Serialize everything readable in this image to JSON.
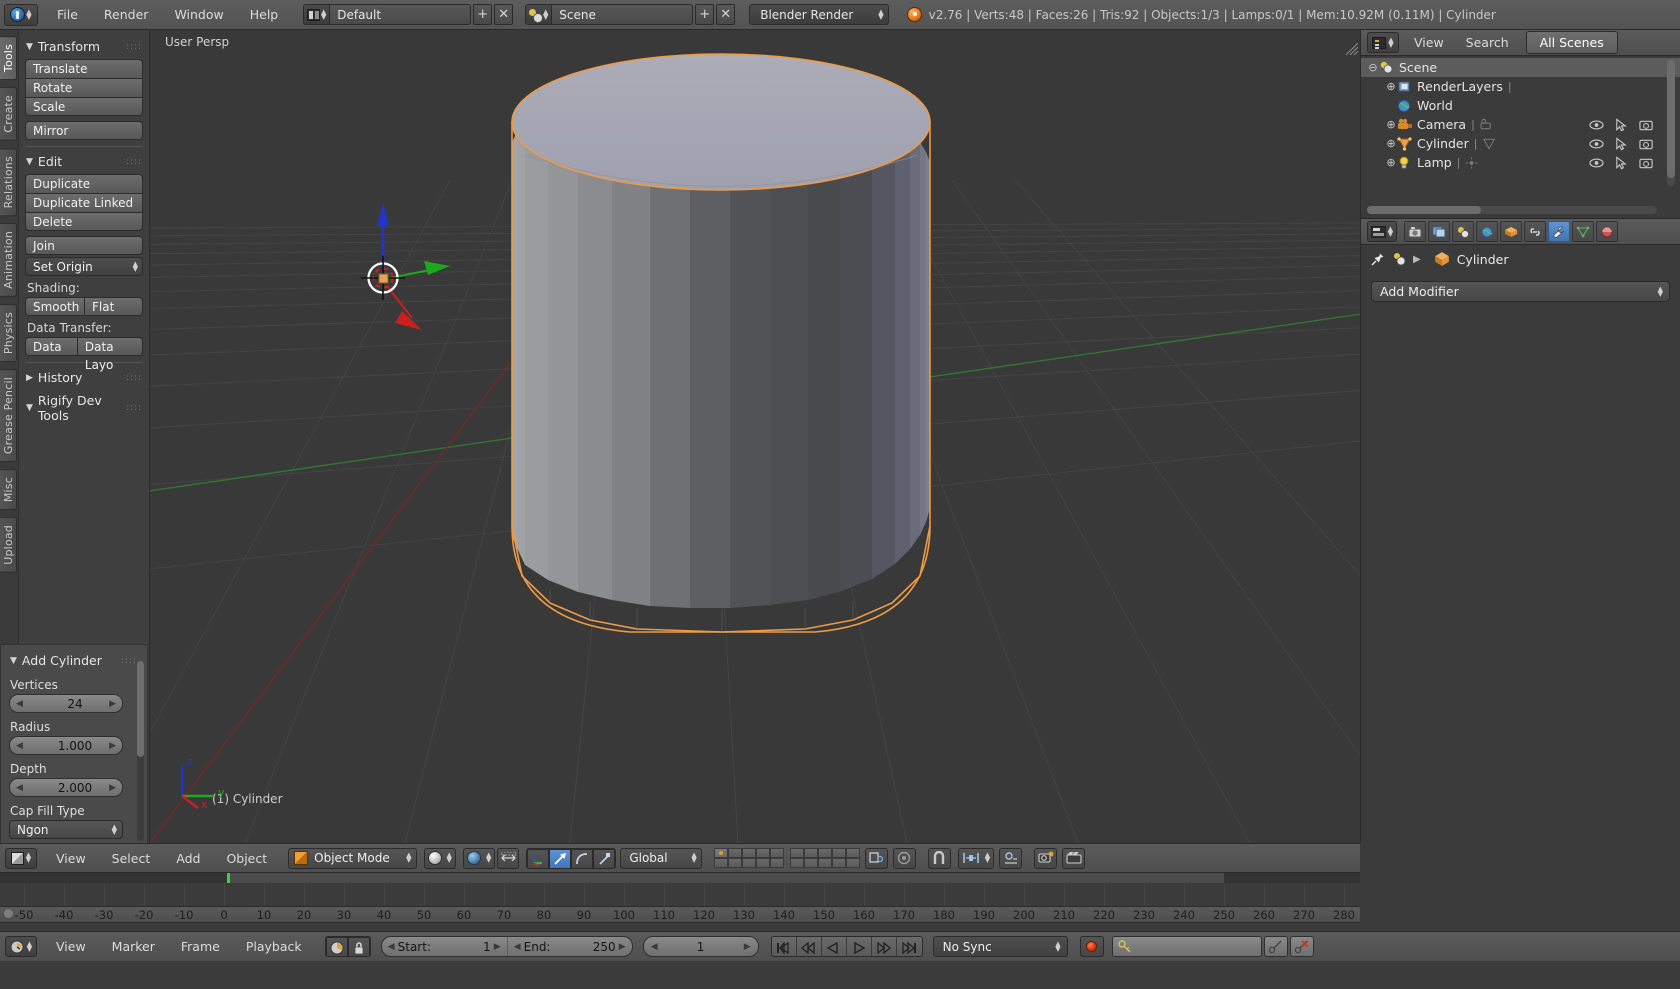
{
  "topbar": {
    "logo_icon": "blender-logo-icon",
    "menus": [
      "File",
      "Render",
      "Window",
      "Help"
    ],
    "screen_layout": {
      "icon": "screen-layout-icon",
      "value": "Default",
      "add_label": "+",
      "delete_label": "✕"
    },
    "scene": {
      "icon": "scene-icon",
      "value": "Scene",
      "add_label": "+",
      "delete_label": "✕"
    },
    "engine": {
      "value": "Blender Render"
    },
    "status": "v2.76 | Verts:48 | Faces:26 | Tris:92 | Objects:1/3 | Lamps:0/1 | Mem:10.92M (0.11M) | Cylinder"
  },
  "toolshelf": {
    "tabs": [
      {
        "label": "Tools",
        "active": true
      },
      {
        "label": "Create",
        "active": false
      },
      {
        "label": "Relations",
        "active": false
      },
      {
        "label": "Animation",
        "active": false
      },
      {
        "label": "Physics",
        "active": false
      },
      {
        "label": "Grease Pencil",
        "active": false
      },
      {
        "label": "Misc",
        "active": false
      },
      {
        "label": "Upload",
        "active": false
      }
    ],
    "transform": {
      "title": "Transform",
      "buttons": [
        "Translate",
        "Rotate",
        "Scale"
      ],
      "mirror": "Mirror"
    },
    "edit": {
      "title": "Edit",
      "buttons": [
        "Duplicate",
        "Duplicate Linked",
        "Delete"
      ],
      "join": "Join",
      "set_origin": "Set Origin",
      "shading_label": "Shading:",
      "shading": [
        "Smooth",
        "Flat"
      ],
      "data_transfer_label": "Data Transfer:",
      "data_transfer": [
        "Data",
        "Data Layo"
      ]
    },
    "history": {
      "title": "History"
    },
    "rigify": {
      "title": "Rigify Dev Tools"
    }
  },
  "operator_panel": {
    "title": "Add Cylinder",
    "fields": [
      {
        "label": "Vertices",
        "value": "24"
      },
      {
        "label": "Radius",
        "value": "1.000"
      },
      {
        "label": "Depth",
        "value": "2.000"
      }
    ],
    "cap_fill_label": "Cap Fill Type",
    "cap_fill_value": "Ngon"
  },
  "viewport": {
    "view_label": "User Persp",
    "object_label": "(1) Cylinder",
    "axis": {
      "x": "x",
      "y": "y",
      "z": "z"
    },
    "colors": {
      "background": "#393939",
      "selection_outline": "#ee9b44",
      "axis_x": "#c0342b",
      "axis_y": "#3db33d",
      "axis_z": "#2b4ec0",
      "cylinder_top": "#a7a8b4",
      "cylinder_light": "#8e8e91",
      "cylinder_dark": "#4a4a4e"
    }
  },
  "view3d_header": {
    "editor_icon": "editor-type-icon",
    "menus": [
      "View",
      "Select",
      "Add",
      "Object"
    ],
    "mode": "Object Mode",
    "viewport_shading_icon": "solid-shading-icon",
    "pivot_icon": "pivot-point-icon",
    "snap_label": "snap-magnet-icon",
    "transform_orientation": "Global",
    "icons": [
      "manipulator-toggle-icon",
      "translate-manipulator-icon",
      "rotate-manipulator-icon",
      "scale-manipulator-icon",
      "layer-grid-icon",
      "lock-scene-icon",
      "proportional-edit-icon",
      "snap-magnet-icon",
      "snap-target-icon",
      "render-opengl-icon",
      "render-opengl-anim-icon"
    ]
  },
  "outliner": {
    "header": {
      "icon": "outliner-icon",
      "menus": [
        "View",
        "Search"
      ],
      "display_mode": "All Scenes"
    },
    "rows": [
      {
        "label": "Scene",
        "icon": "scene-icon",
        "indent": 0,
        "expander": "⊖",
        "selected": true,
        "restrict": false
      },
      {
        "label": "RenderLayers",
        "icon": "renderlayers-icon",
        "indent": 1,
        "expander": "⊕",
        "selected": false,
        "restrict": false
      },
      {
        "label": "World",
        "icon": "world-icon",
        "indent": 1,
        "expander": "",
        "selected": false,
        "restrict": false
      },
      {
        "label": "Camera",
        "icon": "camera-icon",
        "indent": 1,
        "expander": "⊕",
        "selected": false,
        "restrict": true
      },
      {
        "label": "Cylinder",
        "icon": "mesh-icon",
        "indent": 1,
        "expander": "⊕",
        "selected": false,
        "restrict": true
      },
      {
        "label": "Lamp",
        "icon": "lamp-icon",
        "indent": 1,
        "expander": "⊕",
        "selected": false,
        "restrict": true
      }
    ]
  },
  "properties": {
    "header_icon": "properties-editor-icon",
    "tabs": [
      {
        "name": "render-tab",
        "icon": "camera-back-icon",
        "active": false
      },
      {
        "name": "render-layers-tab",
        "icon": "images-icon",
        "active": false
      },
      {
        "name": "scene-tab",
        "icon": "scene-icon",
        "active": false
      },
      {
        "name": "world-tab",
        "icon": "world-icon",
        "active": false
      },
      {
        "name": "object-tab",
        "icon": "cube-icon",
        "active": false
      },
      {
        "name": "constraints-tab",
        "icon": "chain-icon",
        "active": false
      },
      {
        "name": "modifiers-tab",
        "icon": "wrench-icon",
        "active": true
      },
      {
        "name": "data-tab",
        "icon": "mesh-data-icon",
        "active": false
      },
      {
        "name": "material-tab",
        "icon": "material-sphere-icon",
        "active": false
      }
    ],
    "breadcrumb": {
      "pin": "pin-icon",
      "scene": "scene-icon",
      "object": "Cylinder"
    },
    "add_modifier": "Add Modifier"
  },
  "timeline": {
    "header_icon": "timeline-icon",
    "menus": [
      "View",
      "Marker",
      "Frame",
      "Playback"
    ],
    "toggles": [
      "auto-keyframe-icon",
      "lock-icon"
    ],
    "start_label": "Start:",
    "start_value": "1",
    "end_label": "End:",
    "end_value": "250",
    "current_frame": "1",
    "transport": [
      "jump-to-start-icon",
      "prev-keyframe-icon",
      "play-reverse-icon",
      "play-icon",
      "next-keyframe-icon",
      "jump-to-end-icon"
    ],
    "sync_mode": "No Sync",
    "record_icon": "record-icon",
    "keying_set_icon": "keying-set-icon",
    "keying_add_icon": "add-keyframe-icon",
    "keying_remove_icon": "remove-keyframe-icon",
    "ruler_ticks": [
      "-50",
      "-40",
      "-30",
      "-20",
      "-10",
      "0",
      "10",
      "20",
      "30",
      "40",
      "50",
      "60",
      "70",
      "80",
      "90",
      "100",
      "110",
      "120",
      "130",
      "140",
      "150",
      "160",
      "170",
      "180",
      "190",
      "200",
      "210",
      "220",
      "230",
      "240",
      "250",
      "260",
      "270",
      "280"
    ],
    "ruler_min": -56,
    "ruler_max": 284,
    "playhead_frame": 1
  }
}
